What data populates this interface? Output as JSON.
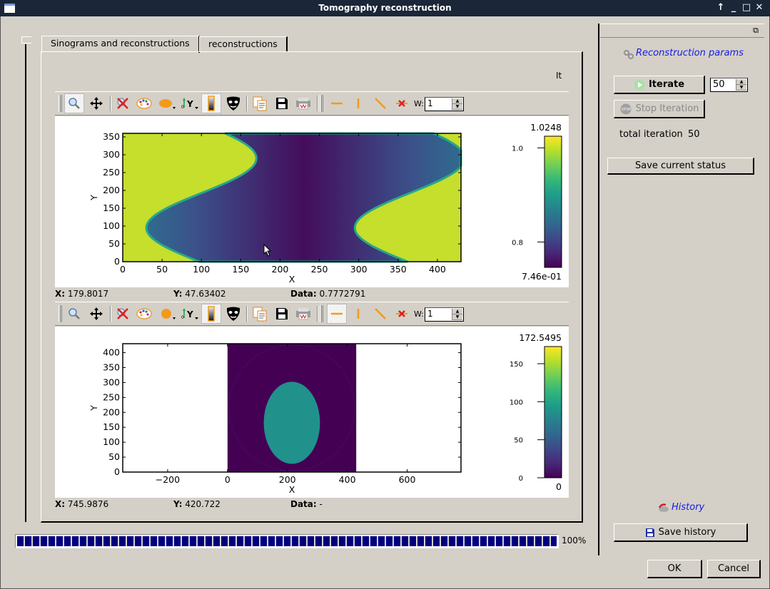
{
  "window": {
    "title": "Tomography reconstruction",
    "controls": [
      "pin-icon",
      "minimize-icon",
      "maximize-icon",
      "close-icon"
    ]
  },
  "tabs": [
    {
      "label": "Sinograms and reconstructions",
      "active": true
    },
    {
      "label": "reconstructions",
      "active": false
    }
  ],
  "tab_header_label": "It",
  "plot_toolbar": {
    "tools": [
      "zoom-icon",
      "pan-icon",
      "reset-zoom-icon",
      "colormap-icon",
      "mask-color-icon",
      "y-axis-orientation-icon",
      "colorbar-icon",
      "mask-tool-icon",
      "copy-icon",
      "save-icon",
      "print-icon"
    ],
    "profile_tools": [
      "horizontal-profile-icon",
      "vertical-profile-icon",
      "diagonal-profile-icon",
      "clear-profile-icon"
    ],
    "width_label": "W:",
    "width_value": "1"
  },
  "sinogram_plot": {
    "chart_data": {
      "type": "heatmap",
      "title": "",
      "xlabel": "X",
      "ylabel": "Y",
      "xlim": [
        0,
        430
      ],
      "ylim": [
        0,
        360
      ],
      "x_ticks": [
        "0",
        "50",
        "100",
        "150",
        "200",
        "250",
        "300",
        "350",
        "400"
      ],
      "y_ticks": [
        "0",
        "50",
        "100",
        "150",
        "200",
        "250",
        "300",
        "350"
      ],
      "colormap": "viridis",
      "colorbar": {
        "max_label": "1.0248",
        "min_label": "7.46e-01",
        "ticks": [
          "1.0",
          "0.8"
        ],
        "vmin": 0.746,
        "vmax": 1.0248
      },
      "description": "Sinusoidal sinogram band"
    },
    "coords": {
      "x_label": "X:",
      "x_value": "179.8017",
      "y_label": "Y:",
      "y_value": "47.63402",
      "data_label": "Data:",
      "data_value": "0.7772791"
    }
  },
  "reconstruction_plot": {
    "chart_data": {
      "type": "heatmap",
      "title": "",
      "xlabel": "X",
      "ylabel": "Y",
      "xlim": [
        -350,
        780
      ],
      "ylim": [
        0,
        430
      ],
      "x_ticks": [
        "−200",
        "0",
        "200",
        "400",
        "600"
      ],
      "y_ticks": [
        "0",
        "50",
        "100",
        "150",
        "200",
        "250",
        "300",
        "350",
        "400"
      ],
      "colormap": "viridis",
      "colorbar": {
        "max_label": "172.5495",
        "min_label": "0",
        "ticks": [
          "150",
          "100",
          "50",
          "0"
        ],
        "vmin": 0,
        "vmax": 172.5495
      },
      "description": "Reconstructed disc on 430x430 image"
    },
    "coords": {
      "x_label": "X:",
      "x_value": "745.9876",
      "y_label": "Y:",
      "y_value": "420.722",
      "data_label": "Data:",
      "data_value": "-"
    }
  },
  "progress": {
    "value": 1.0,
    "label": "100%"
  },
  "side_panel": {
    "reconstruction_title": "Reconstruction params",
    "iterate_label": "Iterate",
    "iterations_value": "50",
    "stop_label": "Stop Iteration",
    "total_iteration_label": "total iteration",
    "total_iteration_value": "50",
    "save_status_label": "Save current status",
    "history_title": "History",
    "save_history_label": "Save history"
  },
  "dialog_buttons": {
    "ok": "OK",
    "cancel": "Cancel"
  },
  "colors": {
    "titlebar": "#1b2638",
    "progress": "#000080",
    "group_title": "#1a1ae6",
    "background": "#d4d0c8"
  }
}
